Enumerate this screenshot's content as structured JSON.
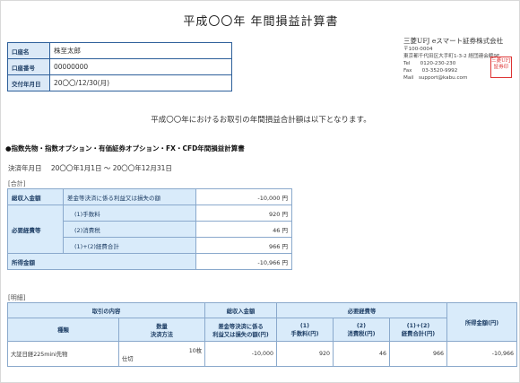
{
  "title": "平成〇〇年 年間損益計算書",
  "account": [
    {
      "label": "口座名",
      "value": "株至太郎"
    },
    {
      "label": "口座番号",
      "value": "00000000"
    },
    {
      "label": "交付年月日",
      "value": "20〇〇/12/30(月)"
    }
  ],
  "company": {
    "name": "三菱UFJ eスマート証券株式会社",
    "postal": "〒100-0004",
    "address": "東京都千代田区大手町1-3-2 経団連会館9F",
    "tel": "Tel　　0120-230-230",
    "fax": "Fax　　03-3520-9992",
    "mail": "Mail　support@kabu.com",
    "seal": "三菱UFJ証券印"
  },
  "intro": "平成〇〇年におけるお取引の年間損益合計額は以下となります。",
  "section_title": "●指数先物・指数オプション・有価証券オプション・FX・CFD年間損益計算書",
  "period": {
    "label": "決済年月日",
    "value": "20〇〇年1月1日 ～ 20〇〇年12月31日"
  },
  "summary": {
    "label": "[合計]",
    "rows": {
      "income_label": "総収入金額",
      "income_desc": "差金等決済に係る利益又は損失の額",
      "income_value": "-10,000 円",
      "expenses_label": "必要経費等",
      "fee_label": "(1)手数料",
      "fee_value": "920 円",
      "tax_label": "(2)消費税",
      "tax_value": "46 円",
      "total_label": "(1)+(2)経費合計",
      "total_value": "966 円",
      "income_amount_label": "所得金額",
      "income_amount_value": "-10,966 円"
    }
  },
  "detail": {
    "label": "[明細]",
    "headers": {
      "content": "取引の内容",
      "total_income": "総収入金額",
      "expenses": "必要経費等",
      "income": "所得金額(円)",
      "type": "種類",
      "qty": "数量",
      "method": "決済方法",
      "pl_line1": "差金等決済に係る",
      "pl_line2": "利益又は損失の額(円)",
      "fee_line1": "(1)",
      "fee_line2": "手数料(円)",
      "tax_line1": "(2)",
      "tax_line2": "消費税(円)",
      "sum_line1": "(1)+(2)",
      "sum_line2": "経費合計(円)"
    },
    "row": {
      "type": "大証日経225mini先物",
      "qty": "10枚",
      "method": "仕切",
      "pl": "-10,000",
      "fee": "920",
      "tax": "46",
      "sum": "966",
      "income": "-10,966"
    }
  }
}
